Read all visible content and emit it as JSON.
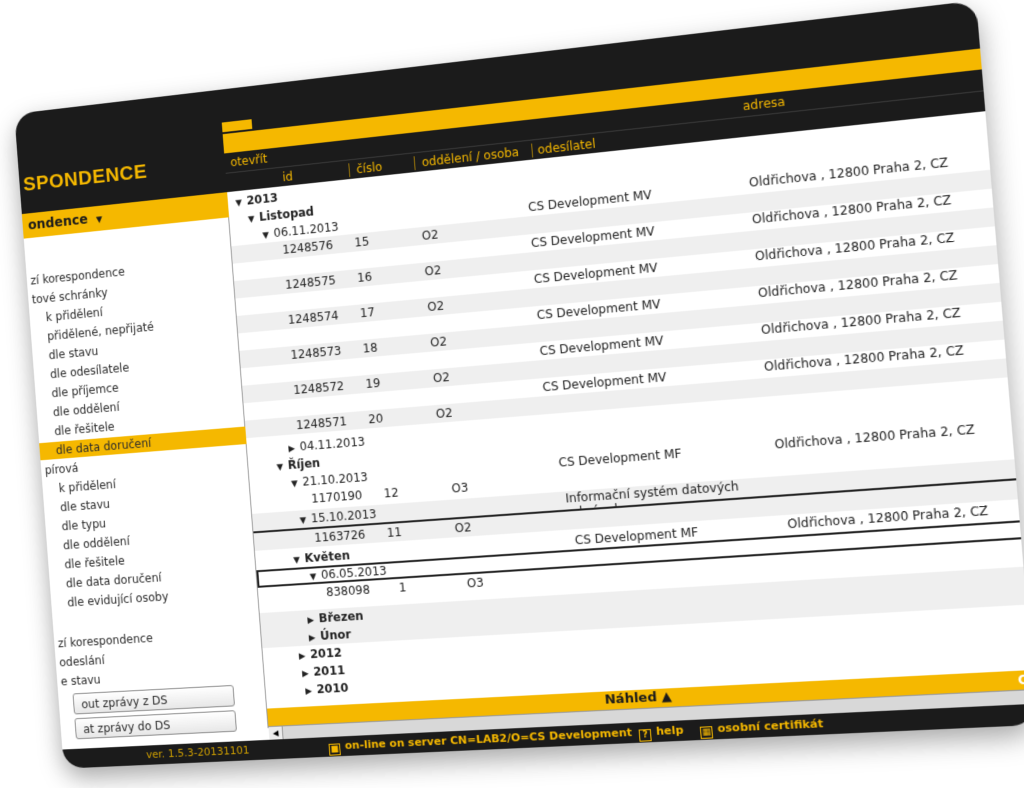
{
  "app": {
    "title": "SPONDENCE"
  },
  "header": {
    "row1": {
      "open": "otevřít",
      "address": "adresa"
    },
    "row2": {
      "id": "id",
      "number": "číslo",
      "dept": "oddělení / osoba",
      "sender": "odesílatel"
    }
  },
  "sidebar": {
    "section_title": "ondence",
    "items": [
      {
        "label": "zí korespondence",
        "indent": 0
      },
      {
        "label": "tové schránky",
        "indent": 0
      },
      {
        "label": "k přidělení",
        "indent": 1
      },
      {
        "label": "přidělené, nepřijaté",
        "indent": 1
      },
      {
        "label": "dle stavu",
        "indent": 1
      },
      {
        "label": "dle odesílatele",
        "indent": 1
      },
      {
        "label": "dle příjemce",
        "indent": 1
      },
      {
        "label": "dle oddělení",
        "indent": 1
      },
      {
        "label": "dle řešitele",
        "indent": 1
      },
      {
        "label": "dle data doručení",
        "indent": 1,
        "active": true
      },
      {
        "label": "pírová",
        "indent": 0
      },
      {
        "label": "k přidělení",
        "indent": 1
      },
      {
        "label": "dle stavu",
        "indent": 1
      },
      {
        "label": "dle typu",
        "indent": 1
      },
      {
        "label": "dle oddělení",
        "indent": 1
      },
      {
        "label": "dle řešitele",
        "indent": 1
      },
      {
        "label": "dle data doručení",
        "indent": 1
      },
      {
        "label": "dle evidující osoby",
        "indent": 1
      },
      {
        "label": "zí korespondence",
        "indent": 0,
        "gap": true
      },
      {
        "label": "odeslání",
        "indent": 0
      },
      {
        "label": "e stavu",
        "indent": 0
      }
    ],
    "buttons": [
      "out zprávy z DS",
      "at zprávy do DS"
    ]
  },
  "tree": {
    "y2013": "2013",
    "listopad": "Listopad",
    "d20131106": "06.11.2013",
    "d20131104": "04.11.2013",
    "rijen": "Říjen",
    "d20131021": "21.10.2013",
    "d20131015": "15.10.2013",
    "kveten": "Květen",
    "d20130506": "06.05.2013",
    "brezen": "Březen",
    "unor": "Únor",
    "y2012": "2012",
    "y2011": "2011",
    "y2010": "2010"
  },
  "records": {
    "r1": {
      "id": "1248576",
      "num": "15",
      "dept": "O2",
      "sender": "CS Development MV",
      "address": "Oldřichova , 12800 Praha 2, CZ"
    },
    "r2": {
      "id": "1248575",
      "num": "16",
      "dept": "O2",
      "sender": "CS Development MV",
      "address": "Oldřichova , 12800 Praha 2, CZ"
    },
    "r3": {
      "id": "1248574",
      "num": "17",
      "dept": "O2",
      "sender": "CS Development MV",
      "address": "Oldřichova , 12800 Praha 2, CZ"
    },
    "r4": {
      "id": "1248573",
      "num": "18",
      "dept": "O2",
      "sender": "CS Development MV",
      "address": "Oldřichova , 12800 Praha 2, CZ"
    },
    "r5": {
      "id": "1248572",
      "num": "19",
      "dept": "O2",
      "sender": "CS Development MV",
      "address": "Oldřichova , 12800 Praha 2, CZ"
    },
    "r6": {
      "id": "1248571",
      "num": "20",
      "dept": "O2",
      "sender": "CS Development MV",
      "address": "Oldřichova , 12800 Praha 2, CZ"
    },
    "r7": {
      "id": "1170190",
      "num": "12",
      "dept": "O3",
      "sender": "CS Development MF",
      "address": "Oldřichova , 12800 Praha 2, CZ"
    },
    "r8": {
      "id": "1163726",
      "num": "11",
      "dept": "O2",
      "sender": "Informační systém datových schránek",
      "address": ""
    },
    "r9": {
      "id": "838098",
      "num": "1",
      "dept": "O3",
      "sender": "CS Development MF",
      "address": "Oldřichova , 12800 Praha 2, CZ"
    }
  },
  "preview": {
    "label": "Náhled ▲",
    "right": "CS"
  },
  "status": {
    "version": "ver. 1.5.3-20131101",
    "server": "on-line on server CN=LAB2/O=CS Development",
    "help": "help",
    "cert": "osobní certifikát"
  },
  "colors": {
    "accent": "#f5b800",
    "dark": "#1b1b1b"
  }
}
